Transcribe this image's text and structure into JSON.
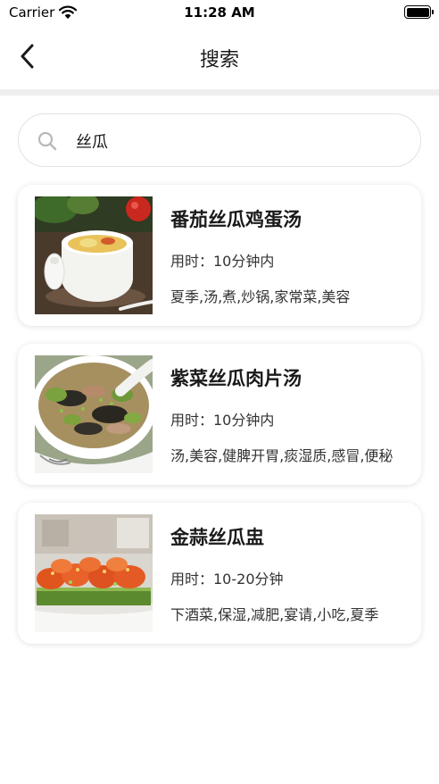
{
  "status_bar": {
    "carrier": "Carrier",
    "time": "11:28 AM"
  },
  "nav": {
    "title": "搜索",
    "back_icon": "chevron-left-icon"
  },
  "search": {
    "value": "丝瓜",
    "icon": "search-icon"
  },
  "results": [
    {
      "title": "番茄丝瓜鸡蛋汤",
      "time": "用时：10分钟内",
      "tags": "夏季,汤,煮,炒锅,家常菜,美容"
    },
    {
      "title": "紫菜丝瓜肉片汤",
      "time": "用时：10分钟内",
      "tags": "汤,美容,健脾开胃,痰湿质,感冒,便秘"
    },
    {
      "title": "金蒜丝瓜盅",
      "time": "用时：10-20分钟",
      "tags": "下酒菜,保湿,减肥,宴请,小吃,夏季"
    }
  ],
  "colors": {
    "divider": "#efefef",
    "card_shadow": "rgba(0,0,0,0.12)",
    "text": "#1a1a1a"
  }
}
